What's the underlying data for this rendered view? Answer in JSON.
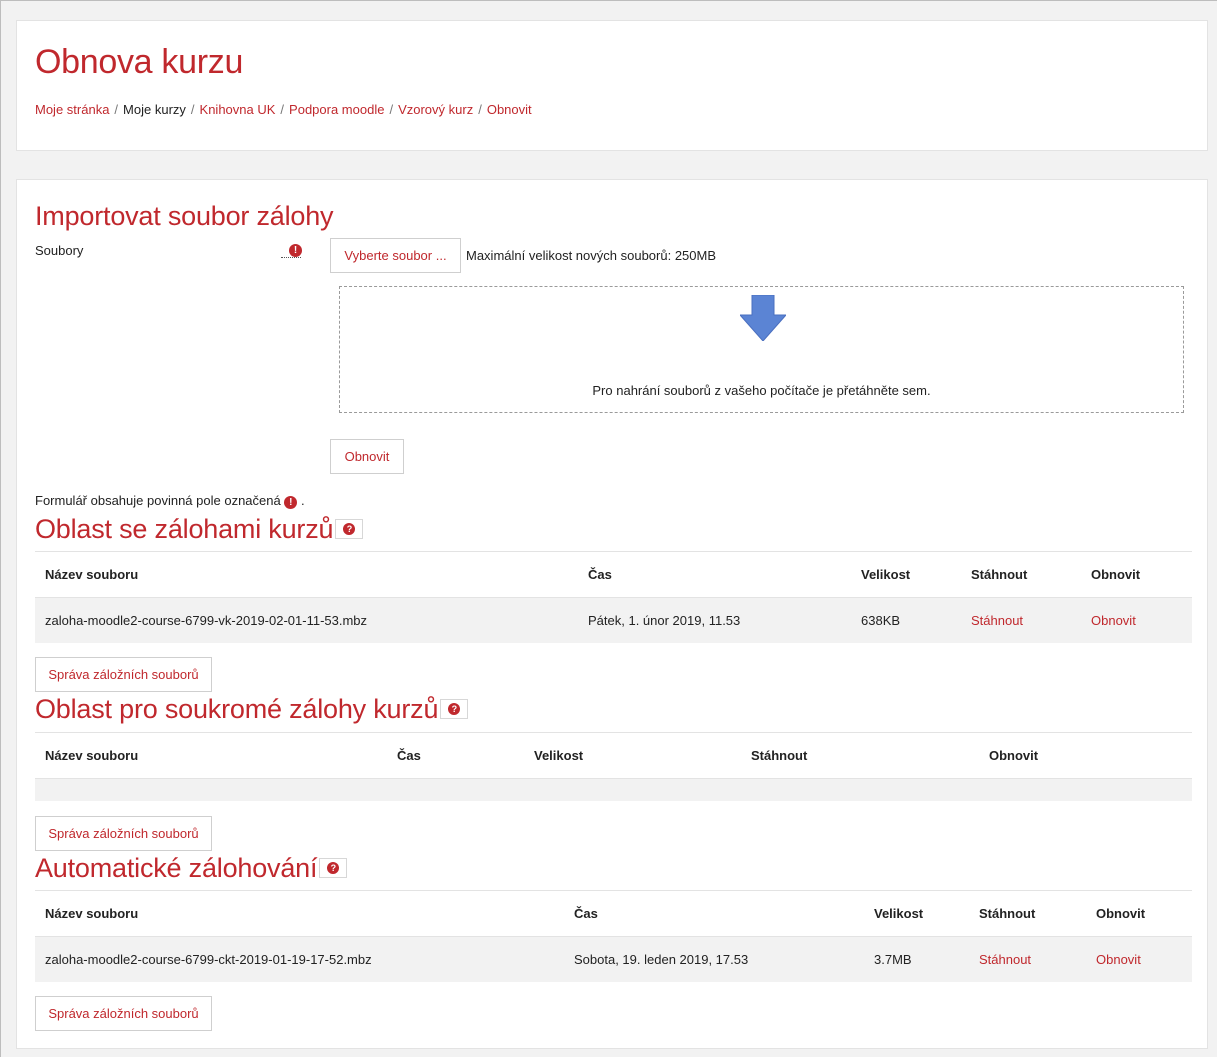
{
  "header": {
    "title": "Obnova kurzu",
    "breadcrumb": [
      "Moje stránka",
      "Moje kurzy",
      "Knihovna UK",
      "Podpora moodle",
      "Vzorový kurz",
      "Obnovit"
    ],
    "separator": "/"
  },
  "import": {
    "title": "Importovat soubor zálohy",
    "files_label": "Soubory",
    "choose_button": "Vyberte soubor ...",
    "max_size": "Maximální velikost nových souborů: 250MB",
    "dropzone_text": "Pro nahrání souborů z vašeho počítače je přetáhněte sem.",
    "restore_button": "Obnovit",
    "required_note": "Formulář obsahuje povinná pole označená",
    "required_suffix": "."
  },
  "course_area": {
    "title": "Oblast se zálohami kurzů",
    "headers": [
      "Název souboru",
      "Čas",
      "Velikost",
      "Stáhnout",
      "Obnovit"
    ],
    "row": {
      "filename": "zaloha-moodle2-course-6799-vk-2019-02-01-11-53.mbz",
      "time": "Pátek, 1. únor 2019, 11.53",
      "size": "638KB",
      "download": "Stáhnout",
      "restore": "Obnovit"
    },
    "manage_button": "Správa záložních souborů"
  },
  "private_area": {
    "title": "Oblast pro soukromé zálohy kurzů",
    "headers": [
      "Název souboru",
      "Čas",
      "Velikost",
      "Stáhnout",
      "Obnovit"
    ],
    "manage_button": "Správa záložních souborů"
  },
  "auto_area": {
    "title": "Automatické zálohování",
    "headers": [
      "Název souboru",
      "Čas",
      "Velikost",
      "Stáhnout",
      "Obnovit"
    ],
    "row": {
      "filename": "zaloha-moodle2-course-6799-ckt-2019-01-19-17-52.mbz",
      "time": "Sobota, 19. leden 2019, 17.53",
      "size": "3.7MB",
      "download": "Stáhnout",
      "restore": "Obnovit"
    },
    "manage_button": "Správa záložních souborů"
  },
  "icons": {
    "required": "exclamation-circle-icon",
    "help": "question-circle-icon",
    "upload": "down-arrow-icon"
  },
  "colors": {
    "accent": "#c0282d",
    "row_background": "#f2f2f2",
    "page_background": "#f2f2f2",
    "arrow": "#5b84d4"
  }
}
